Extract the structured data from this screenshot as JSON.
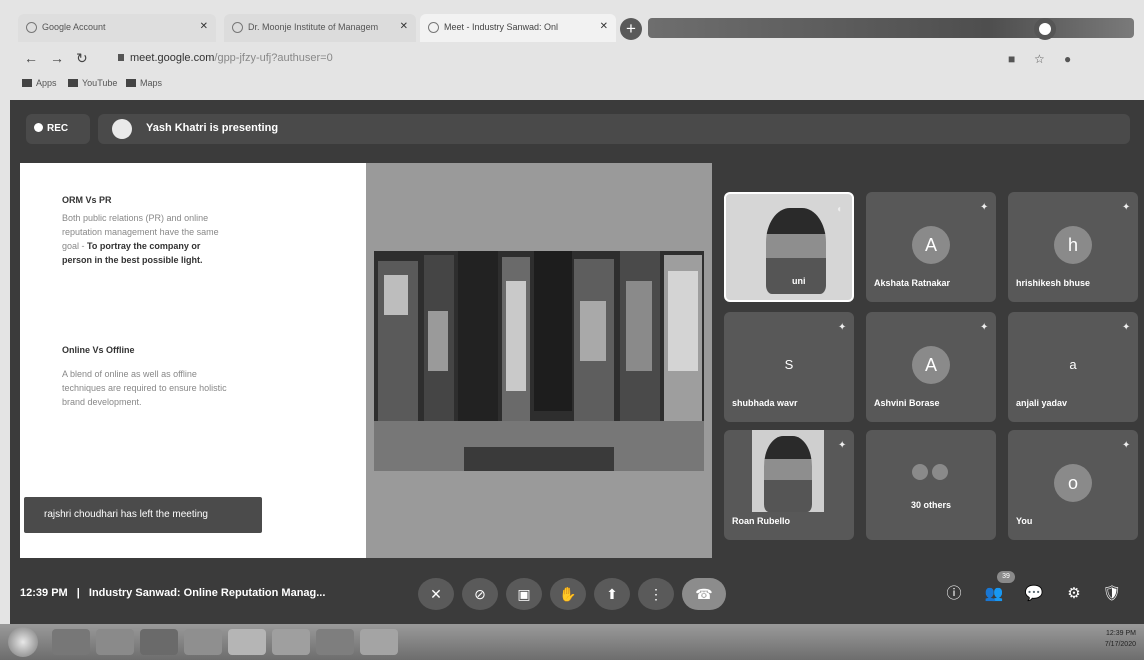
{
  "browser": {
    "tabs": [
      {
        "label": "Google Account"
      },
      {
        "label": "Dr. Moonje Institute of Managem"
      },
      {
        "label": "Meet - Industry Sanwad: Onl"
      }
    ],
    "url_host": "meet.google.com",
    "url_path": "/gpp-jfzy-ufj?authuser=0",
    "bookmarks": [
      "Apps",
      "YouTube",
      "Maps"
    ]
  },
  "meet": {
    "rec_label": "REC",
    "presenting_label": "Yash Khatri is presenting",
    "slide": {
      "heading1": "ORM Vs PR",
      "para1": "Both public relations (PR) and online reputation management have the same goal -",
      "para1_bold": "To portray the company or person in the best possible light.",
      "heading2": "Online Vs Offline",
      "para2": "A blend of online as well as offline techniques are required to ensure holistic brand development."
    },
    "toast": "rajshri choudhari has left the meeting",
    "participants": [
      {
        "name": "uni",
        "type": "video",
        "letter": ""
      },
      {
        "name": "Akshata Ratnakar",
        "type": "avatar",
        "letter": "A"
      },
      {
        "name": "hrishikesh bhuse",
        "type": "avatar",
        "letter": "h"
      },
      {
        "name": "shubhada wavr",
        "type": "plain",
        "letter": "S"
      },
      {
        "name": "Ashvini Borase",
        "type": "avatar",
        "letter": "A"
      },
      {
        "name": "anjali yadav",
        "type": "plain",
        "letter": "a"
      },
      {
        "name": "Roan Rubello",
        "type": "video",
        "letter": ""
      },
      {
        "name": "30 others",
        "type": "others",
        "letter": ""
      },
      {
        "name": "You",
        "type": "avatar",
        "letter": "o"
      }
    ],
    "bottom": {
      "time": "12:39 PM",
      "separator": "|",
      "title": "Industry Sanwad: Online Reputation Manag...",
      "people_count": "39"
    }
  },
  "taskbar": {
    "clock": "12:39 PM",
    "date": "7/17/2020"
  }
}
